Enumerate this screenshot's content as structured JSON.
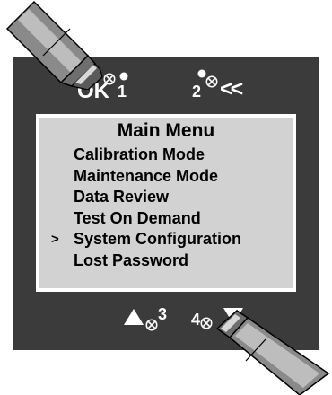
{
  "buttons": {
    "ok": {
      "label": "OK",
      "number": "1"
    },
    "back": {
      "number": "2",
      "glyph": "<<"
    },
    "up": {
      "number": "3"
    },
    "down": {
      "number": "4"
    }
  },
  "screen": {
    "title": "Main Menu",
    "cursor": ">",
    "items": [
      {
        "label": "Calibration Mode",
        "selected": false
      },
      {
        "label": "Maintenance Mode",
        "selected": false
      },
      {
        "label": "Data Review",
        "selected": false
      },
      {
        "label": "Test On Demand",
        "selected": false
      },
      {
        "label": "System Configuration",
        "selected": true
      },
      {
        "label": "Lost Password",
        "selected": false
      }
    ]
  },
  "colors": {
    "panel": "#3b3b3b",
    "screen": "#d2d2d2",
    "key_text": "#ffffff",
    "probe_body": "#8a8a8a"
  },
  "icons": {
    "ok_key": "magnet-target-icon",
    "back_key": "magnet-target-icon",
    "up_key": "triangle-up-icon",
    "down_key": "triangle-down-icon",
    "probes": "magnet-wand-icon"
  }
}
